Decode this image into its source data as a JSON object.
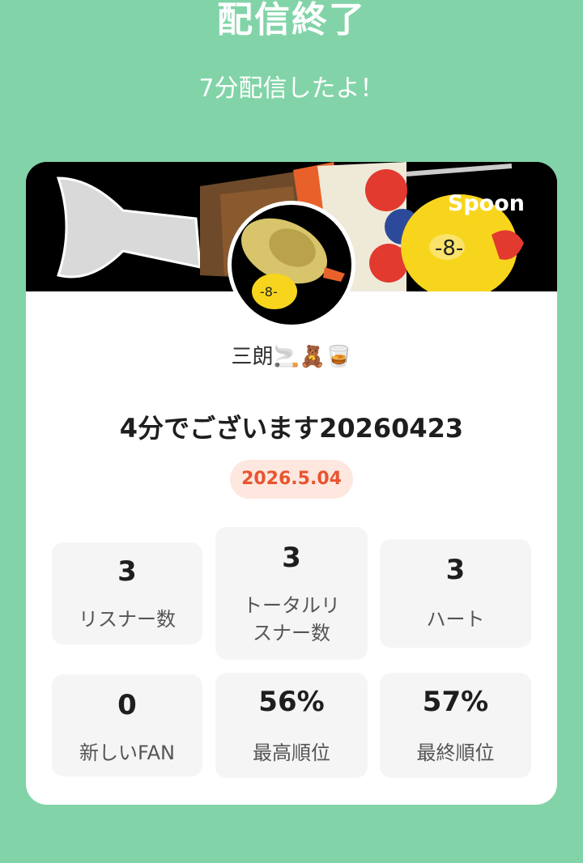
{
  "header": {
    "title": "配信終了",
    "subtitle": "7分配信したよ！"
  },
  "card": {
    "brand": "Spoon",
    "username": "三朗🚬🧸🥃",
    "live_title": "4分でございます20260423",
    "date": "2026.5.04",
    "stats": [
      {
        "value": "3",
        "label": "リスナー数"
      },
      {
        "value": "3",
        "label": "トータルリスナー数"
      },
      {
        "value": "3",
        "label": "ハート"
      },
      {
        "value": "0",
        "label": "新しいFAN"
      },
      {
        "value": "56%",
        "label": "最高順位"
      },
      {
        "value": "57%",
        "label": "最終順位"
      }
    ]
  },
  "colors": {
    "background": "#82d4a8",
    "card": "#ffffff",
    "badge_bg": "#fde7df",
    "badge_text": "#e8542f",
    "stat_bg": "#f5f5f5"
  }
}
